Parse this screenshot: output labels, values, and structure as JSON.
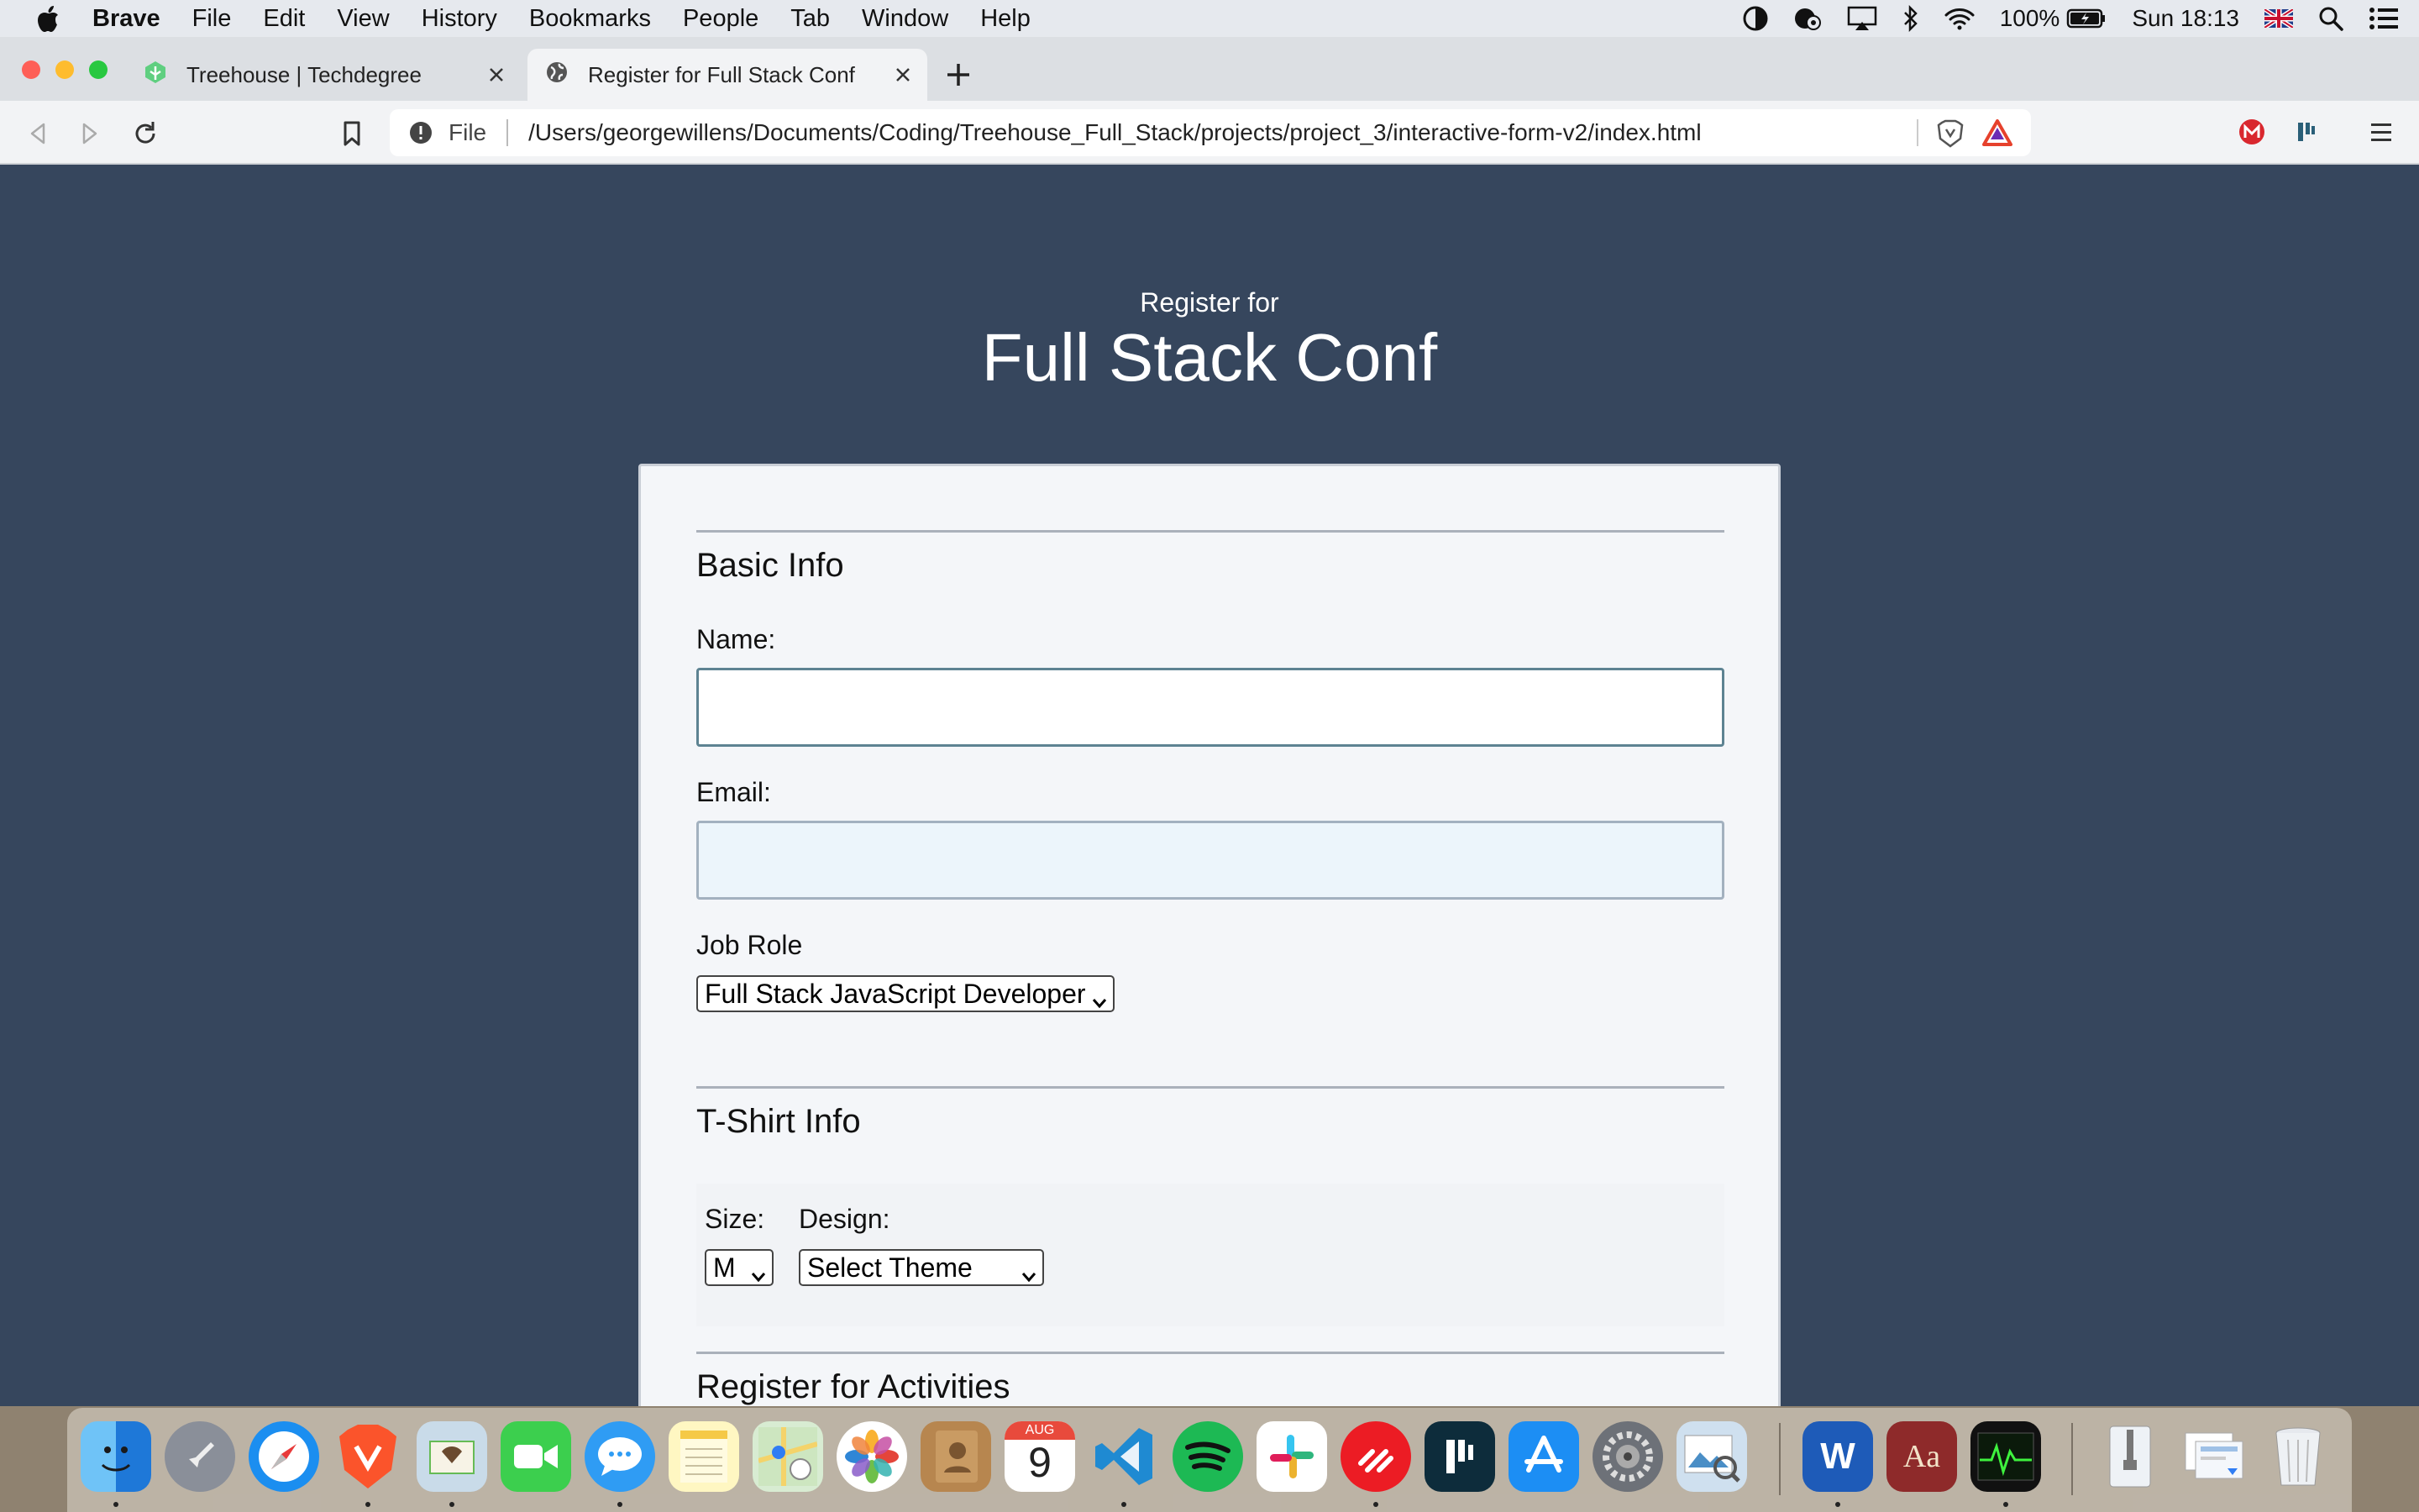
{
  "menubar": {
    "app_name": "Brave",
    "items": [
      "File",
      "Edit",
      "View",
      "History",
      "Bookmarks",
      "People",
      "Tab",
      "Window",
      "Help"
    ],
    "battery": "100%",
    "clock": "Sun 18:13",
    "icons": [
      "contrast-icon",
      "creative-cloud-icon",
      "airplay-icon",
      "bluetooth-icon",
      "wifi-icon",
      "battery-icon",
      "flag-uk-icon",
      "spotlight-search-icon",
      "notification-center-icon"
    ]
  },
  "browser": {
    "tabs": [
      {
        "title": "Treehouse | Techdegree",
        "icon": "treehouse-icon",
        "active": false
      },
      {
        "title": "Register for Full Stack Conf",
        "icon": "globe-icon",
        "active": true
      }
    ],
    "address": {
      "scheme_label": "File",
      "url": "/Users/georgewillens/Documents/Coding/Treehouse_Full_Stack/projects/project_3/interactive-form-v2/index.html"
    }
  },
  "page": {
    "subtitle": "Register for",
    "title": "Full Stack Conf",
    "basic_info": {
      "heading": "Basic Info",
      "name_label": "Name:",
      "name_value": "",
      "email_label": "Email:",
      "email_value": "",
      "job_role_label": "Job Role",
      "job_role_selected": "Full Stack JavaScript Developer"
    },
    "tshirt": {
      "heading": "T-Shirt Info",
      "size_label": "Size:",
      "size_selected": "M",
      "design_label": "Design:",
      "design_selected": "Select Theme"
    },
    "activities": {
      "heading": "Register for Activities"
    }
  },
  "colors": {
    "page_background": "#36465d",
    "card_background": "#f4f6f9",
    "name_input_border": "#5d8392",
    "email_input_background": "#ecf5fb",
    "brave_orange": "#fb542b"
  },
  "dock": {
    "apps": [
      "finder",
      "launchpad",
      "safari",
      "brave",
      "mail",
      "facetime",
      "messages",
      "notes",
      "maps",
      "photos",
      "contacts",
      "calendar",
      "vscode",
      "spotify",
      "slack",
      "authy",
      "dashlane",
      "app-store",
      "system-preferences",
      "preview",
      "word",
      "dictionary",
      "activity-monitor",
      "archive",
      "downloads",
      "trash"
    ],
    "calendar": {
      "month": "AUG",
      "day": "9"
    }
  }
}
